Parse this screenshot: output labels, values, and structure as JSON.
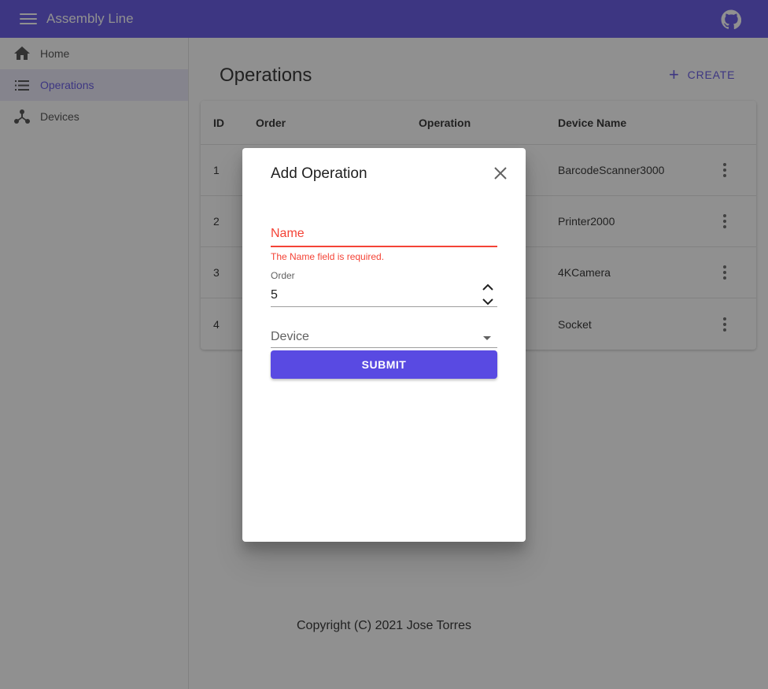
{
  "appbar": {
    "title": "Assembly Line",
    "github_icon": "github-icon",
    "color": "#594ae2"
  },
  "sidebar": {
    "items": [
      {
        "label": "Home",
        "icon": "home-icon",
        "active": false
      },
      {
        "label": "Operations",
        "icon": "list-icon",
        "active": true
      },
      {
        "label": "Devices",
        "icon": "devices-icon",
        "active": false
      }
    ]
  },
  "page": {
    "title": "Operations",
    "create_label": "CREATE"
  },
  "table": {
    "headers": [
      "ID",
      "Order",
      "Operation",
      "Device Name"
    ],
    "rows": [
      {
        "id": "1",
        "order": "",
        "operation": "",
        "device": "BarcodeScanner3000"
      },
      {
        "id": "2",
        "order": "",
        "operation": "",
        "device": "Printer2000"
      },
      {
        "id": "3",
        "order": "",
        "operation": "",
        "device": "4KCamera"
      },
      {
        "id": "4",
        "order": "",
        "operation": "",
        "device": "Socket"
      }
    ]
  },
  "dialog": {
    "title": "Add Operation",
    "name_label": "Name",
    "name_error": "The Name field is required.",
    "order_label": "Order",
    "order_value": "5",
    "device_label": "Device",
    "submit_label": "SUBMIT"
  },
  "footer": {
    "text": "Copyright (C) 2021 Jose Torres"
  },
  "colors": {
    "primary": "#594ae2",
    "error": "#f44336"
  }
}
